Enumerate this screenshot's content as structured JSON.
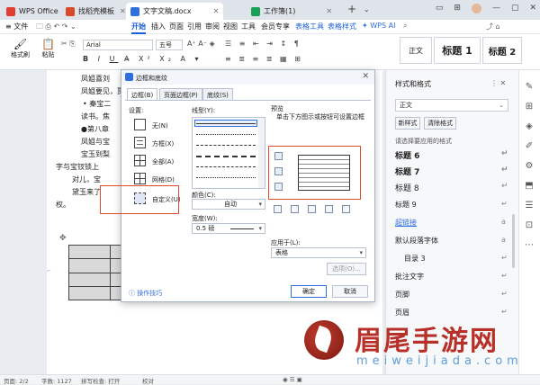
{
  "tabs": [
    {
      "label": "WPS Office",
      "color": "#e03c31"
    },
    {
      "label": "找稻壳模板",
      "color": "#d64a2a"
    },
    {
      "label": "文字文稿.docx",
      "color": "#2f6fe0"
    },
    {
      "label": "工作簿(1)",
      "color": "#18a058"
    }
  ],
  "menu": {
    "file": "文件",
    "items": [
      "开始",
      "插入",
      "页面",
      "引用",
      "审阅",
      "视图",
      "工具",
      "会员专享"
    ],
    "table_tools": "表格工具",
    "table_style": "表格样式",
    "wps_ai": "WPS AI"
  },
  "ribbon": {
    "format_painter": "格式刷",
    "paste": "粘贴",
    "font_name": "Arial",
    "font_size": "五号",
    "style_normal": "正文",
    "style_h1": "标题 1",
    "style_h2": "标题 2"
  },
  "document": {
    "lines": [
      "凤姐喜刘",
      "凤姐要见，贾",
      "• 秦宝二",
      "读书。焦",
      "●第八章",
      "凤姐与宝",
      "宝玉到梨",
      "字与宝钗锁上",
      "对儿，宝",
      "黛玉来了",
      "权。"
    ]
  },
  "dialog": {
    "title": "边框和底纹",
    "tabs": [
      "边框(B)",
      "页面边框(P)",
      "底纹(S)"
    ],
    "settings_label": "设置:",
    "settings": [
      "无(N)",
      "方框(X)",
      "全部(A)",
      "网格(D)",
      "自定义(U)"
    ],
    "style_label": "线型(Y):",
    "color_label": "颜色(C):",
    "color_value": "自动",
    "width_label": "宽度(W):",
    "width_value": "0.5  磅",
    "preview_label": "预览",
    "preview_hint": "单击下方图示或按钮可设置边框",
    "apply_label": "应用于(L):",
    "apply_value": "表格",
    "options_button": "选项(O)...",
    "tips": "操作技巧",
    "ok": "确定",
    "cancel": "取消"
  },
  "styles_panel": {
    "title": "样式和格式",
    "current": "正文",
    "new_style": "新样式",
    "clear_format": "清除格式",
    "hint": "请选择要应用的格式",
    "items": [
      "标题 6",
      "标题 7",
      "标题 8",
      "标题 9",
      "超链接",
      "默认段落字体",
      "目录 3",
      "批注文字",
      "页脚",
      "页眉"
    ]
  },
  "statusbar": {
    "page": "页面: 2/2",
    "words": "字数: 1127",
    "spell": "拼写检查: 打开",
    "proof": "校对"
  },
  "watermark": {
    "text": "眉尾手游网",
    "sub": "meiweijiada.com"
  }
}
